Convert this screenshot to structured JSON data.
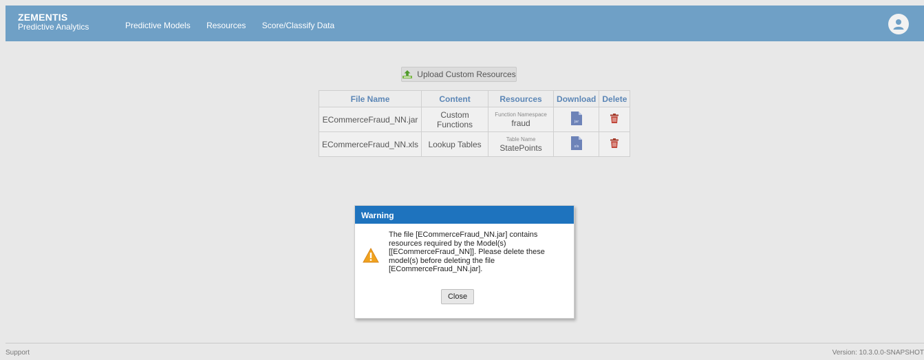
{
  "header": {
    "brand_name": "ZEMENTIS",
    "brand_sub": "Predictive Analytics",
    "nav": [
      "Predictive Models",
      "Resources",
      "Score/Classify Data"
    ],
    "bg_color": "#6fa0c6"
  },
  "upload": {
    "label": "Upload Custom Resources"
  },
  "table": {
    "headers": [
      "File Name",
      "Content",
      "Resources",
      "Download",
      "Delete"
    ],
    "rows": [
      {
        "file_name": "ECommerceFraud_NN.jar",
        "content": "Custom Functions",
        "resource_label": "Function Namespace",
        "resource_value": "fraud",
        "download_icon": "jar-file-icon"
      },
      {
        "file_name": "ECommerceFraud_NN.xls",
        "content": "Lookup Tables",
        "resource_label": "Table Name",
        "resource_value": "StatePoints",
        "download_icon": "xls-file-icon"
      }
    ]
  },
  "dialog": {
    "title": "Warning",
    "message": "The file [ECommerceFraud_NN.jar] contains resources required by the Model(s) [[ECommerceFraud_NN]]. Please delete these model(s) before deleting the file [ECommerceFraud_NN.jar].",
    "close_label": "Close",
    "header_color": "#1e73be"
  },
  "footer": {
    "support": "Support",
    "version": "Version: 10.3.0.0-SNAPSHOT"
  }
}
